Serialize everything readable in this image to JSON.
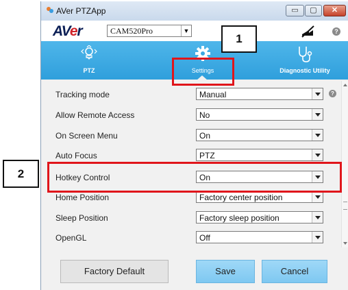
{
  "window": {
    "title": "AVer PTZApp",
    "controls": {
      "minimize": "▭",
      "maximize": "▢",
      "close": "✕"
    }
  },
  "header": {
    "logo": {
      "main": "AV",
      "accent": "e",
      "tail": "r"
    },
    "camera_select": {
      "value": "CAM520Pro"
    },
    "mute_icon": "camera-muted-icon",
    "help": "?"
  },
  "nav": {
    "items": [
      {
        "label": "PTZ",
        "icon": "ptz-icon"
      },
      {
        "label": "Settings",
        "icon": "gear-icon",
        "active": true
      },
      {
        "label": "Diagnostic Utility",
        "icon": "stethoscope-icon"
      }
    ]
  },
  "settings": {
    "rows": [
      {
        "label": "Tracking mode",
        "value": "Manual",
        "help": "?"
      },
      {
        "label": "Allow Remote Access",
        "value": "No"
      },
      {
        "label": "On Screen Menu",
        "value": "On"
      },
      {
        "label": "Auto Focus",
        "value": "PTZ"
      },
      {
        "label": "Hotkey Control",
        "value": "On"
      },
      {
        "label": "Home Position",
        "value": "Factory center position"
      },
      {
        "label": "Sleep Position",
        "value": "Factory sleep position"
      },
      {
        "label": "OpenGL",
        "value": "Off"
      }
    ]
  },
  "footer": {
    "factory_default": "Factory Default",
    "save": "Save",
    "cancel": "Cancel"
  },
  "annotations": {
    "callout_1": "1",
    "callout_2": "2",
    "highlight_color": "#e0151b"
  },
  "colors": {
    "nav_blue": "#3aa8e2",
    "button_blue": "#8fd0f4"
  }
}
